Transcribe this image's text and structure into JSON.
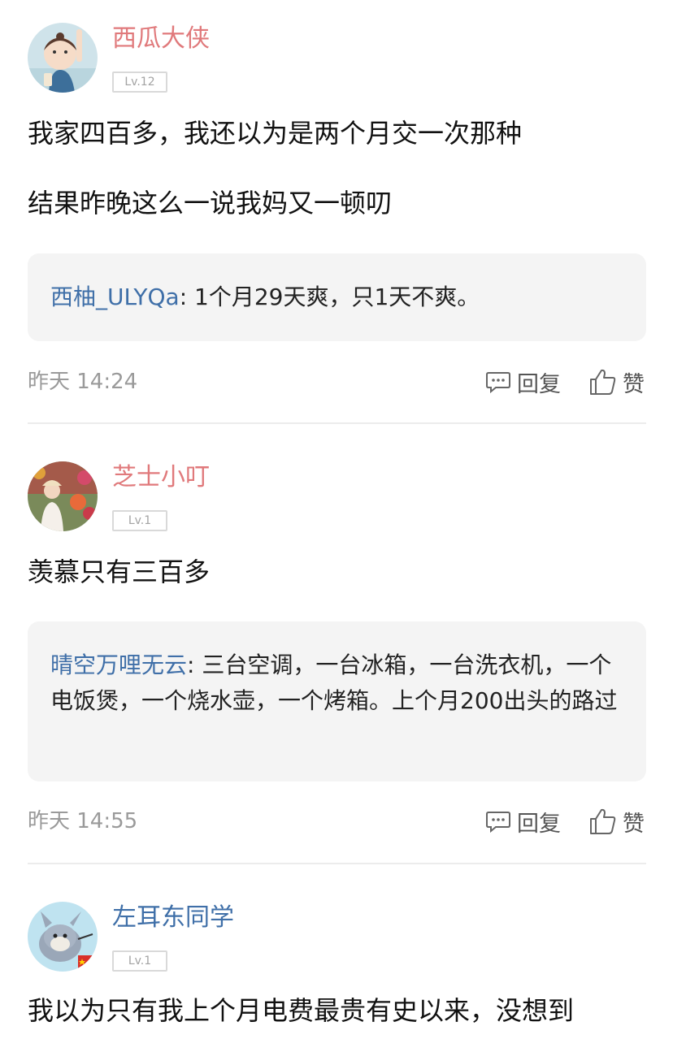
{
  "comments": [
    {
      "username": "西瓜大侠",
      "level": "Lv.12",
      "lines": [
        "我家四百多，我还以为是两个月交一次那种",
        "结果昨晚这么一说我妈又一顿叨"
      ],
      "quote": {
        "name": "西柚_ULYQa",
        "sep": ": ",
        "text": "1个月29天爽，只1天不爽。"
      },
      "time": "昨天 14:24",
      "reply_label": "回复",
      "like_label": "赞"
    },
    {
      "username": "芝士小叮",
      "level": "Lv.1",
      "lines": [
        "羡慕只有三百多"
      ],
      "quote": {
        "name": "晴空万哩无云",
        "sep": ": ",
        "text": "三台空调，一台冰箱，一台洗衣机，一个电饭煲，一个烧水壶，一个烤箱。上个月200出头的路过"
      },
      "time": "昨天 14:55",
      "reply_label": "回复",
      "like_label": "赞"
    },
    {
      "username": "左耳东同学",
      "level": "Lv.1",
      "lines": [
        "我以为只有我上个月电费最贵有史以来，没想到"
      ]
    }
  ],
  "colors": {
    "username_red": "#e0797b",
    "username_blue": "#3f6fa8",
    "quote_name": "#3f6fa8",
    "meta_gray": "#9a9a9a",
    "quote_bg": "#f4f4f4"
  },
  "icons": [
    "comment-bubble-icon",
    "thumbs-up-icon"
  ]
}
